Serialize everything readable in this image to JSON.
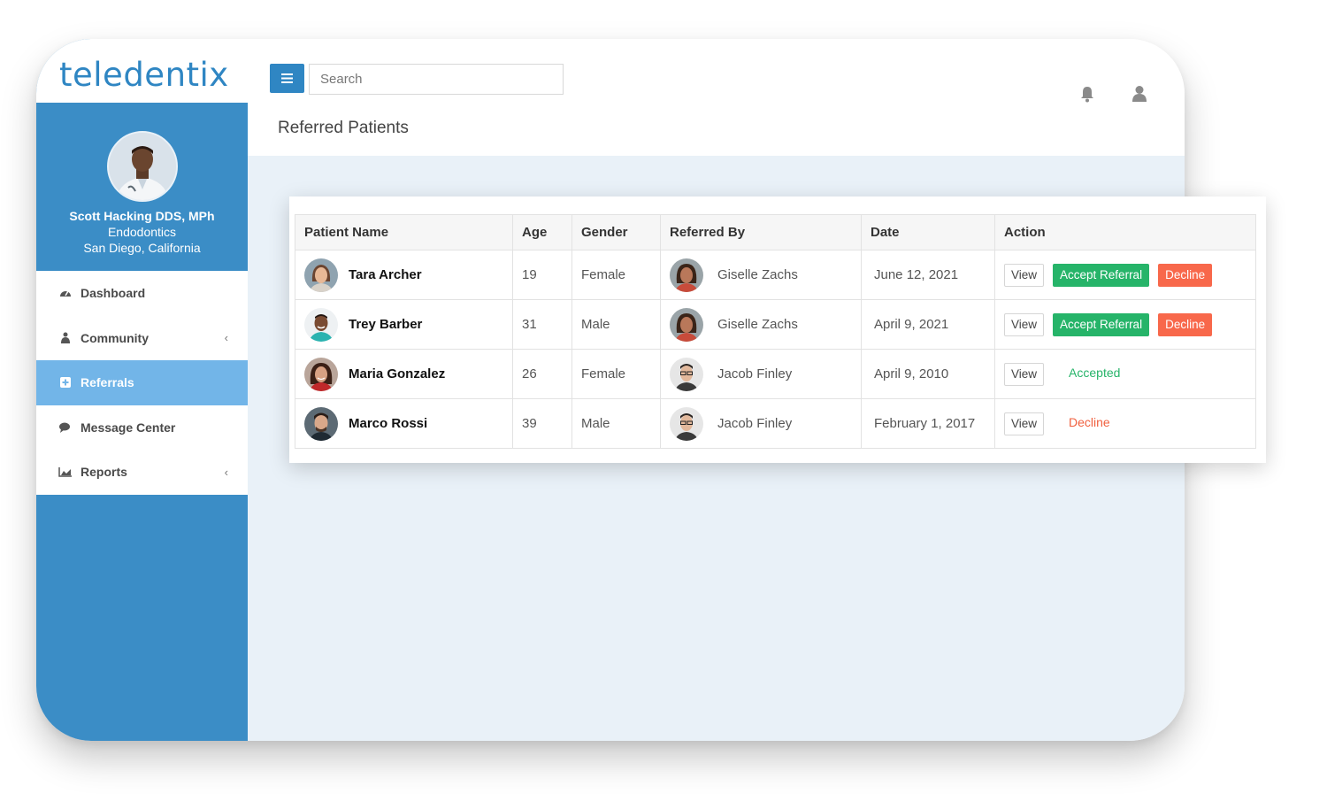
{
  "brand": {
    "logo": "teledentix",
    "primary_color": "#2f86c3",
    "accent_green": "#26b469",
    "accent_red": "#f8684b"
  },
  "profile": {
    "name": "Scott Hacking DDS, MPh",
    "specialty": "Endodontics",
    "location": "San Diego, California"
  },
  "sidebar": {
    "items": [
      {
        "label": "Dashboard",
        "icon": "dashboard-icon"
      },
      {
        "label": "Community",
        "icon": "community-icon",
        "expandable": true
      },
      {
        "label": "Referrals",
        "icon": "plus-square-icon",
        "active": true
      },
      {
        "label": "Message Center",
        "icon": "chat-icon"
      },
      {
        "label": "Reports",
        "icon": "chart-icon",
        "expandable": true
      }
    ]
  },
  "topbar": {
    "menu_icon": "hamburger-icon",
    "search_placeholder": "Search",
    "notification_icon": "bell-icon",
    "account_icon": "user-icon"
  },
  "page": {
    "title": "Referred Patients"
  },
  "table": {
    "headers": [
      "Patient Name",
      "Age",
      "Gender",
      "Referred By",
      "Date",
      "Action"
    ],
    "rows": [
      {
        "patient": "Tara Archer",
        "age": "19",
        "gender": "Female",
        "referred_by": "Giselle Zachs",
        "date": "June 12, 2021",
        "view": "View",
        "accept": "Accept Referral",
        "decline": "Decline"
      },
      {
        "patient": "Trey Barber",
        "age": "31",
        "gender": "Male",
        "referred_by": "Giselle Zachs",
        "date": "April 9, 2021",
        "view": "View",
        "accept": "Accept Referral",
        "decline": "Decline"
      },
      {
        "patient": "Maria Gonzalez",
        "age": "26",
        "gender": "Female",
        "referred_by": "Jacob Finley",
        "date": "April 9, 2010",
        "view": "View",
        "status": "Accepted"
      },
      {
        "patient": "Marco Rossi",
        "age": "39",
        "gender": "Male",
        "referred_by": "Jacob Finley",
        "date": "February 1, 2017",
        "view": "View",
        "status": "Decline"
      }
    ]
  }
}
